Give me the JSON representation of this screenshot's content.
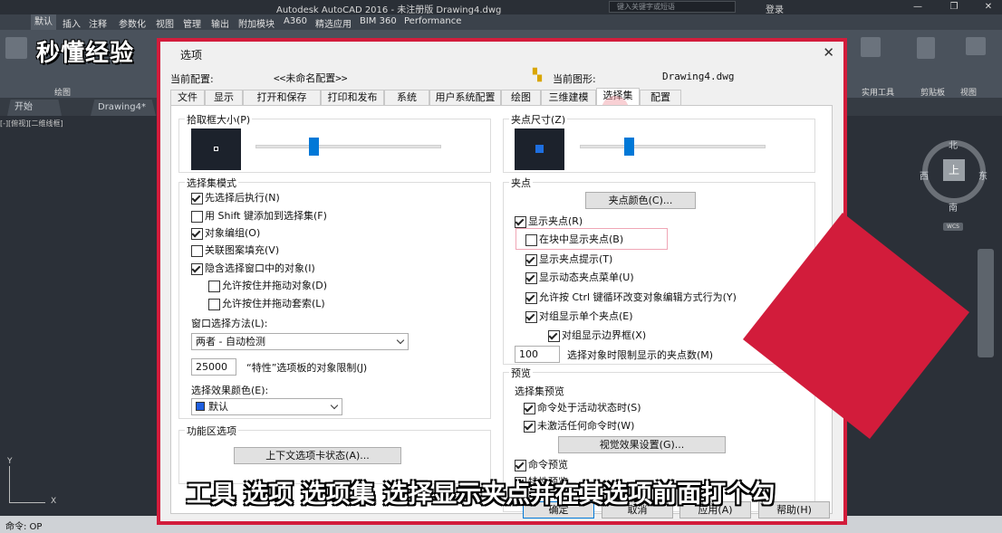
{
  "app": {
    "title": "Autodesk AutoCAD 2016 - 未注册版    Drawing4.dwg",
    "search_placeholder": "键入关键字或短语",
    "login": "登录",
    "menu": [
      "默认",
      "插入",
      "注释",
      "参数化",
      "视图",
      "管理",
      "输出",
      "附加模块",
      "A360",
      "精选应用",
      "BIM 360",
      "Performance"
    ],
    "ribbon_groups": {
      "draw": "绘图",
      "tools": "实用工具",
      "clipboard": "剪贴板",
      "view": "视图"
    },
    "doc_tabs": [
      "开始",
      "Drawing4*"
    ],
    "viewport_label": "[-][俯视][二维线框]",
    "command": "命令: OP",
    "navcube": {
      "north": "北",
      "south": "南",
      "west": "西",
      "east": "东",
      "top": "上",
      "wcs": "WCS"
    },
    "axis": {
      "y": "Y",
      "x": "X"
    }
  },
  "dialog": {
    "title": "选项",
    "current_profile_label": "当前配置:",
    "current_profile": "<<未命名配置>>",
    "current_drawing_label": "当前图形:",
    "current_drawing": "Drawing4.dwg",
    "tabs": [
      "文件",
      "显示",
      "打开和保存",
      "打印和发布",
      "系统",
      "用户系统配置",
      "绘图",
      "三维建模",
      "选择集",
      "配置"
    ],
    "active_tab": "选择集",
    "pickbox": {
      "title": "拾取框大小(P)",
      "level": 0.3
    },
    "grip_size": {
      "title": "夹点尺寸(Z)",
      "level": 0.25
    },
    "selection_modes": {
      "title": "选择集模式",
      "items": [
        {
          "label": "先选择后执行(N)",
          "checked": true
        },
        {
          "label": "用 Shift 键添加到选择集(F)",
          "checked": false
        },
        {
          "label": "对象编组(O)",
          "checked": true
        },
        {
          "label": "关联图案填充(V)",
          "checked": false
        },
        {
          "label": "隐含选择窗口中的对象(I)",
          "checked": true
        },
        {
          "label": "允许按住并拖动对象(D)",
          "checked": false
        },
        {
          "label": "允许按住并拖动套索(L)",
          "checked": false
        }
      ],
      "window_method_label": "窗口选择方法(L):",
      "window_method_value": "两者 - 自动检测",
      "limit_value": "25000",
      "limit_label": "“特性”选项板的对象限制(J)",
      "effect_color_label": "选择效果颜色(E):",
      "effect_color_value": "默认",
      "effect_color_hex": "#1f5fe0"
    },
    "ribbon_options": {
      "title": "功能区选项",
      "button": "上下文选项卡状态(A)..."
    },
    "grips": {
      "title": "夹点",
      "color_button": "夹点颜色(C)...",
      "items": [
        {
          "label": "显示夹点(R)",
          "checked": true
        },
        {
          "label": "在块中显示夹点(B)",
          "checked": false
        },
        {
          "label": "显示夹点提示(T)",
          "checked": true
        },
        {
          "label": "显示动态夹点菜单(U)",
          "checked": true
        },
        {
          "label": "允许按 Ctrl 键循环改变对象编辑方式行为(Y)",
          "checked": true
        },
        {
          "label": "对组显示单个夹点(E)",
          "checked": true
        },
        {
          "label": "对组显示边界框(X)",
          "checked": true
        }
      ],
      "limit_value": "100",
      "limit_label": "选择对象时限制显示的夹点数(M)"
    },
    "preview": {
      "title": "预览",
      "subtitle": "选择集预览",
      "items": [
        {
          "label": "命令处于活动状态时(S)",
          "checked": true
        },
        {
          "label": "未激活任何命令时(W)",
          "checked": true
        }
      ],
      "effect_button": "视觉效果设置(G)...",
      "items2": [
        {
          "label": "命令预览",
          "checked": true
        },
        {
          "label": "特性预览",
          "checked": true
        }
      ]
    },
    "buttons": {
      "ok": "确定",
      "cancel": "取消",
      "apply": "应用(A)",
      "help": "帮助(H)"
    }
  },
  "overlay": {
    "logo": "秒懂经验",
    "subtitle": "工具 选项 选项集 选择显示夹点并在其选项前面打个勾",
    "accent": "#d21c3b"
  }
}
